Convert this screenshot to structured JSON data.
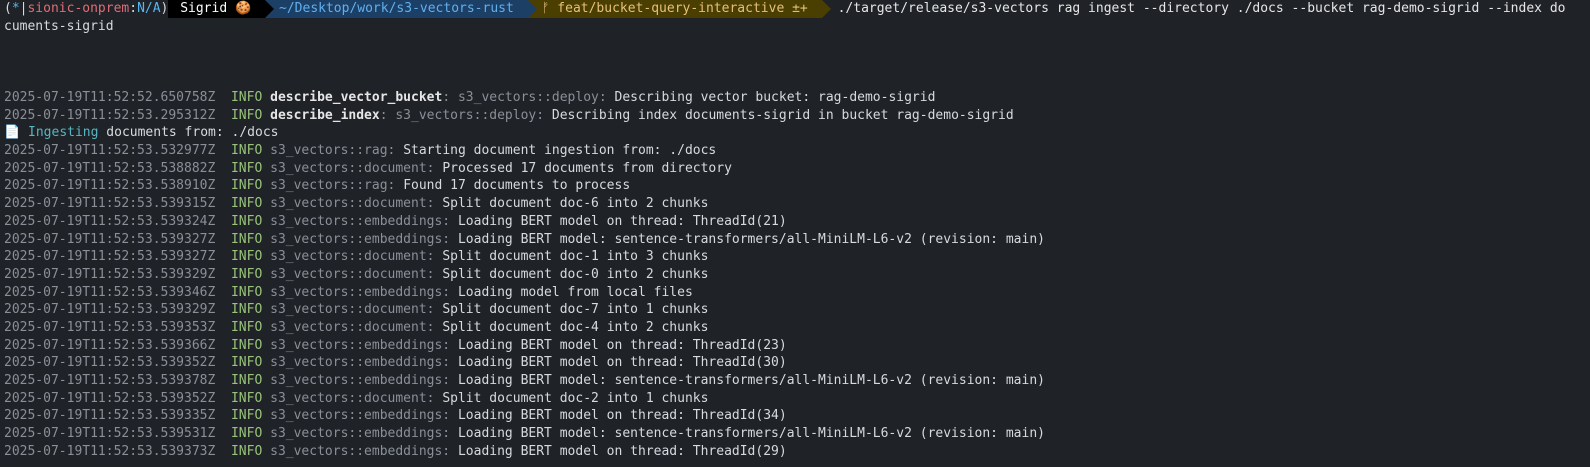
{
  "prompt": {
    "context_open": "(",
    "context_star": "*",
    "context_sep": "|",
    "context_cluster": "sionic-onprem",
    "context_colon": ":",
    "context_ns": "N/A",
    "context_close": ")",
    "user": "Sigrid",
    "user_icon": "🍪",
    "directory": "~/Desktop/work/s3-vectors-rust",
    "git_icon": "ᚠ",
    "git_branch": "feat/bucket-query-interactive",
    "git_status": "±+",
    "command_line1": "./target/release/s3-vectors rag ingest --directory ./docs --bucket rag-demo-sigrid --index do",
    "command_line2": "cuments-sigrid"
  },
  "ingest_notice": {
    "icon": "📄",
    "word": "Ingesting",
    "text": " documents from: ./docs"
  },
  "logs_top": [
    {
      "ts": "2025-07-19T11:52:52.650758Z",
      "level": "INFO",
      "span": "describe_vector_bucket",
      "target": "s3_vectors::deploy:",
      "msg": "Describing vector bucket: rag-demo-sigrid"
    },
    {
      "ts": "2025-07-19T11:52:53.295312Z",
      "level": "INFO",
      "span": "describe_index",
      "target": "s3_vectors::deploy:",
      "msg": "Describing index documents-sigrid in bucket rag-demo-sigrid"
    }
  ],
  "logs": [
    {
      "ts": "2025-07-19T11:52:53.532977Z",
      "level": "INFO",
      "target": "s3_vectors::rag:",
      "msg": "Starting document ingestion from: ./docs"
    },
    {
      "ts": "2025-07-19T11:52:53.538882Z",
      "level": "INFO",
      "target": "s3_vectors::document:",
      "msg": "Processed 17 documents from directory"
    },
    {
      "ts": "2025-07-19T11:52:53.538910Z",
      "level": "INFO",
      "target": "s3_vectors::rag:",
      "msg": "Found 17 documents to process"
    },
    {
      "ts": "2025-07-19T11:52:53.539315Z",
      "level": "INFO",
      "target": "s3_vectors::document:",
      "msg": "Split document doc-6 into 2 chunks"
    },
    {
      "ts": "2025-07-19T11:52:53.539324Z",
      "level": "INFO",
      "target": "s3_vectors::embeddings:",
      "msg": "Loading BERT model on thread: ThreadId(21)"
    },
    {
      "ts": "2025-07-19T11:52:53.539327Z",
      "level": "INFO",
      "target": "s3_vectors::embeddings:",
      "msg": "Loading BERT model: sentence-transformers/all-MiniLM-L6-v2 (revision: main)"
    },
    {
      "ts": "2025-07-19T11:52:53.539327Z",
      "level": "INFO",
      "target": "s3_vectors::document:",
      "msg": "Split document doc-1 into 3 chunks"
    },
    {
      "ts": "2025-07-19T11:52:53.539329Z",
      "level": "INFO",
      "target": "s3_vectors::document:",
      "msg": "Split document doc-0 into 2 chunks"
    },
    {
      "ts": "2025-07-19T11:52:53.539346Z",
      "level": "INFO",
      "target": "s3_vectors::embeddings:",
      "msg": "Loading model from local files"
    },
    {
      "ts": "2025-07-19T11:52:53.539329Z",
      "level": "INFO",
      "target": "s3_vectors::document:",
      "msg": "Split document doc-7 into 1 chunks"
    },
    {
      "ts": "2025-07-19T11:52:53.539353Z",
      "level": "INFO",
      "target": "s3_vectors::document:",
      "msg": "Split document doc-4 into 2 chunks"
    },
    {
      "ts": "2025-07-19T11:52:53.539366Z",
      "level": "INFO",
      "target": "s3_vectors::embeddings:",
      "msg": "Loading BERT model on thread: ThreadId(23)"
    },
    {
      "ts": "2025-07-19T11:52:53.539352Z",
      "level": "INFO",
      "target": "s3_vectors::embeddings:",
      "msg": "Loading BERT model on thread: ThreadId(30)"
    },
    {
      "ts": "2025-07-19T11:52:53.539378Z",
      "level": "INFO",
      "target": "s3_vectors::embeddings:",
      "msg": "Loading BERT model: sentence-transformers/all-MiniLM-L6-v2 (revision: main)"
    },
    {
      "ts": "2025-07-19T11:52:53.539352Z",
      "level": "INFO",
      "target": "s3_vectors::document:",
      "msg": "Split document doc-2 into 1 chunks"
    },
    {
      "ts": "2025-07-19T11:52:53.539335Z",
      "level": "INFO",
      "target": "s3_vectors::embeddings:",
      "msg": "Loading BERT model on thread: ThreadId(34)"
    },
    {
      "ts": "2025-07-19T11:52:53.539531Z",
      "level": "INFO",
      "target": "s3_vectors::embeddings:",
      "msg": "Loading BERT model: sentence-transformers/all-MiniLM-L6-v2 (revision: main)"
    },
    {
      "ts": "2025-07-19T11:52:53.539373Z",
      "level": "INFO",
      "target": "s3_vectors::embeddings:",
      "msg": "Loading BERT model on thread: ThreadId(29)"
    }
  ],
  "colors": {
    "background": "#1f2227",
    "info": "#98c379",
    "dir_segment": "#1c3f66",
    "git_segment": "#4a3e00",
    "ingesting": "#56b6c2"
  }
}
